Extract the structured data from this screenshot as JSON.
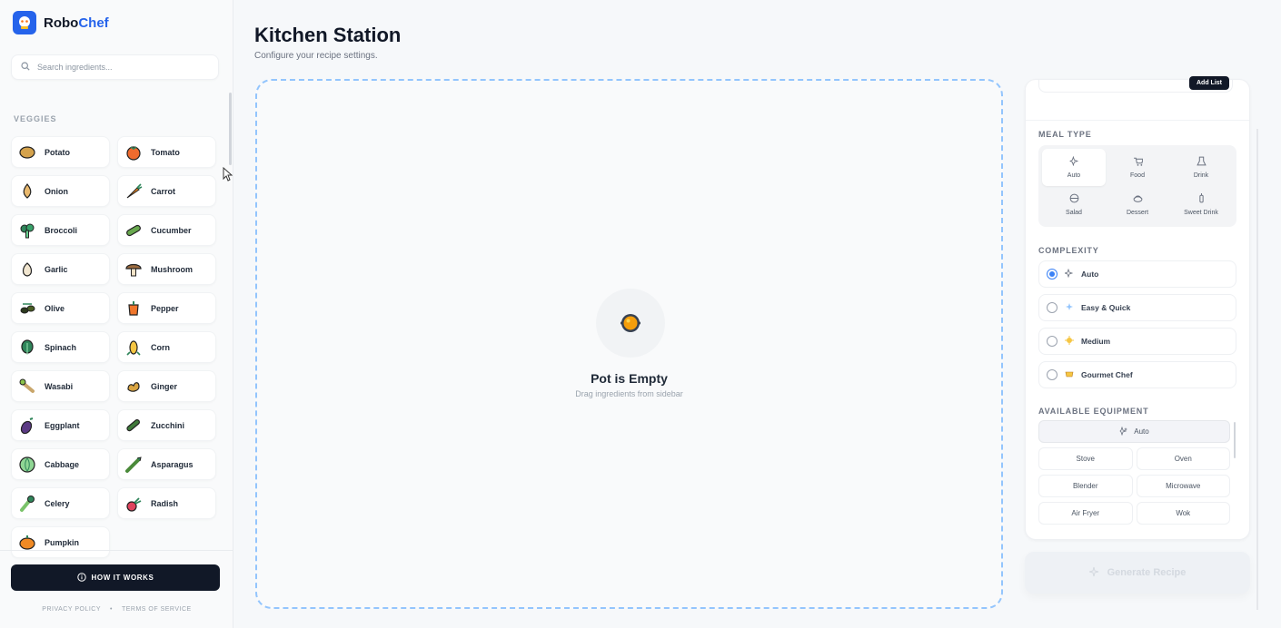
{
  "brand": {
    "name_main": "Robo",
    "name_accent": "Chef"
  },
  "search": {
    "placeholder": "Search ingredients..."
  },
  "sidebar": {
    "section": "VEGGIES",
    "ingredients": [
      {
        "label": "Potato",
        "icon": "potato-icon"
      },
      {
        "label": "Tomato",
        "icon": "tomato-icon"
      },
      {
        "label": "Onion",
        "icon": "onion-icon"
      },
      {
        "label": "Carrot",
        "icon": "carrot-icon"
      },
      {
        "label": "Broccoli",
        "icon": "broccoli-icon"
      },
      {
        "label": "Cucumber",
        "icon": "cucumber-icon"
      },
      {
        "label": "Garlic",
        "icon": "garlic-icon"
      },
      {
        "label": "Mushroom",
        "icon": "mushroom-icon"
      },
      {
        "label": "Olive",
        "icon": "olive-icon"
      },
      {
        "label": "Pepper",
        "icon": "pepper-icon"
      },
      {
        "label": "Spinach",
        "icon": "spinach-icon"
      },
      {
        "label": "Corn",
        "icon": "corn-icon"
      },
      {
        "label": "Wasabi",
        "icon": "wasabi-icon"
      },
      {
        "label": "Ginger",
        "icon": "ginger-icon"
      },
      {
        "label": "Eggplant",
        "icon": "eggplant-icon"
      },
      {
        "label": "Zucchini",
        "icon": "zucchini-icon"
      },
      {
        "label": "Cabbage",
        "icon": "cabbage-icon"
      },
      {
        "label": "Asparagus",
        "icon": "asparagus-icon"
      },
      {
        "label": "Celery",
        "icon": "celery-icon"
      },
      {
        "label": "Radish",
        "icon": "radish-icon"
      },
      {
        "label": "Pumpkin",
        "icon": "pumpkin-icon"
      }
    ],
    "how_it_works": "HOW IT WORKS",
    "privacy": "PRIVACY POLICY",
    "separator": "•",
    "terms": "TERMS OF SERVICE"
  },
  "main": {
    "title": "Kitchen Station",
    "subtitle": "Configure your recipe settings.",
    "pot_title": "Pot is Empty",
    "pot_sub": "Drag ingredients from sidebar"
  },
  "panel": {
    "add_list": "Add List",
    "meal_type_label": "MEAL TYPE",
    "meal_types": [
      {
        "label": "Auto",
        "active": true
      },
      {
        "label": "Food",
        "active": false
      },
      {
        "label": "Drink",
        "active": false
      },
      {
        "label": "Salad",
        "active": false
      },
      {
        "label": "Dessert",
        "active": false
      },
      {
        "label": "Sweet Drink",
        "active": false
      }
    ],
    "complexity_label": "COMPLEXITY",
    "complexity": [
      {
        "label": "Auto",
        "selected": true
      },
      {
        "label": "Easy & Quick",
        "selected": false
      },
      {
        "label": "Medium",
        "selected": false
      },
      {
        "label": "Gourmet Chef",
        "selected": false
      }
    ],
    "equipment_label": "AVAILABLE EQUIPMENT",
    "equipment_auto": "Auto",
    "equipment": [
      "Stove",
      "Oven",
      "Blender",
      "Microwave",
      "Air Fryer",
      "Wok"
    ],
    "generate": "Generate Recipe"
  },
  "colors": {
    "accent": "#2563eb",
    "dark_button": "#111827",
    "dashed_border": "#93c5fd"
  }
}
